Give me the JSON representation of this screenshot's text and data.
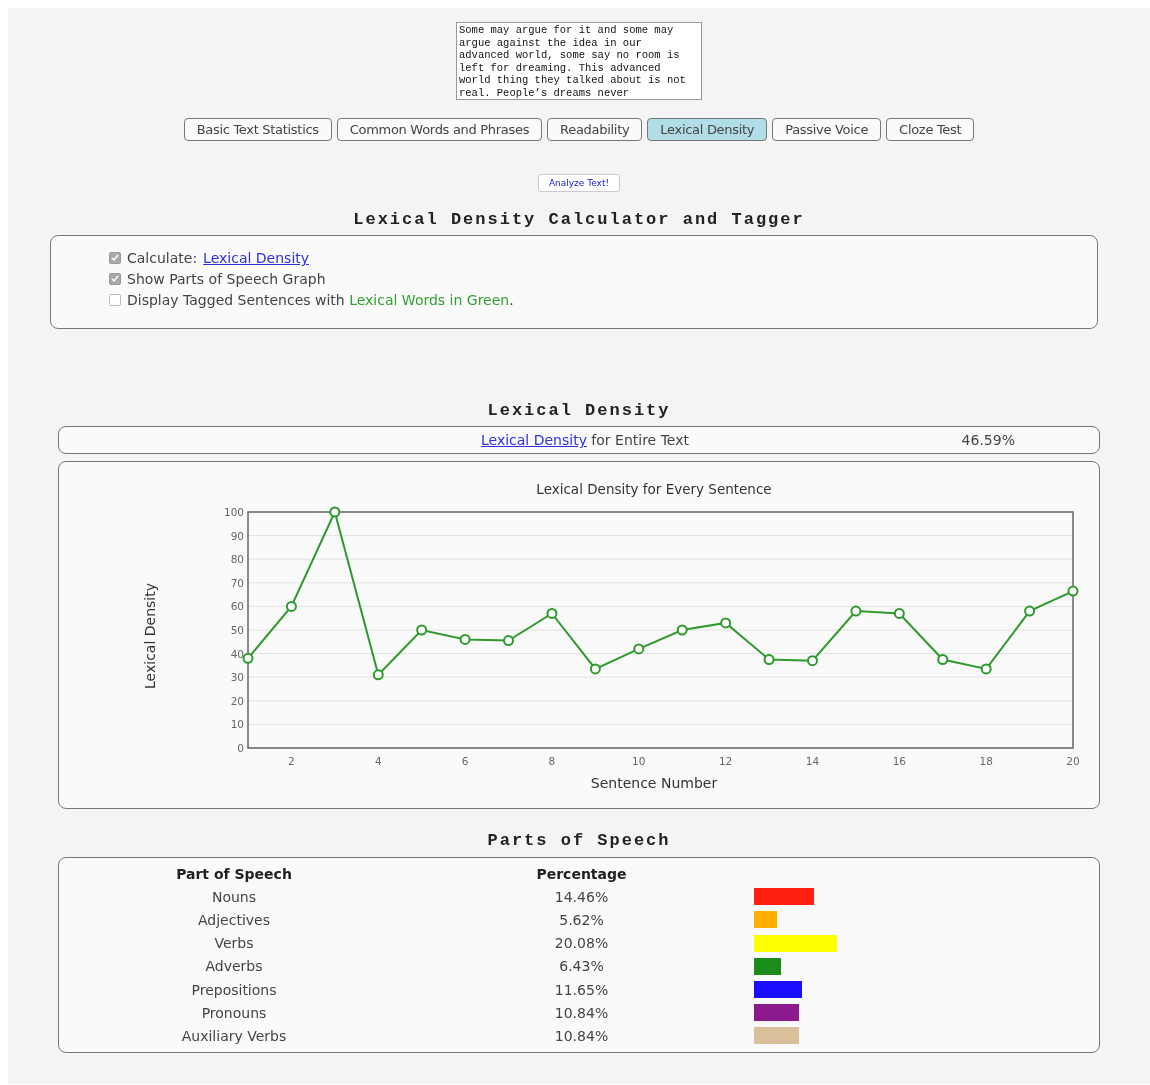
{
  "text_input": {
    "value": "Some may argue for it and some may argue against the idea in our advanced world, some say no room is left for dreaming. This advanced world thing they talked about is not real. People’s dreams never"
  },
  "tabs": [
    {
      "label": "Basic Text Statistics",
      "selected": false
    },
    {
      "label": "Common Words and Phrases",
      "selected": false
    },
    {
      "label": "Readability",
      "selected": false
    },
    {
      "label": "Lexical Density",
      "selected": true
    },
    {
      "label": "Passive Voice",
      "selected": false
    },
    {
      "label": "Cloze Test",
      "selected": false
    }
  ],
  "analyze_button": "Analyze Text!",
  "heading": "Lexical Density Calculator and Tagger",
  "options": [
    {
      "label": "Calculate: ",
      "link": "Lexical Density",
      "checked": true
    },
    {
      "label": "Show Parts of Speech Graph",
      "checked": true
    },
    {
      "label": "Display Tagged Sentences with ",
      "highlight": "Lexical Words in Green",
      "suffix": ".",
      "checked": false
    }
  ],
  "density_heading": "Lexical Density",
  "result": {
    "link": "Lexical Density",
    "label": " for Entire Text",
    "value": "46.59%"
  },
  "chart": {
    "chart_data": {
      "type": "line",
      "title": "Lexical Density for Every Sentence",
      "xlabel": "Sentence Number",
      "ylabel": "Lexical Density",
      "x": [
        1,
        2,
        3,
        4,
        5,
        6,
        7,
        8,
        9,
        10,
        11,
        12,
        13,
        14,
        15,
        16,
        17,
        18,
        19,
        20
      ],
      "grid": true,
      "series": [
        {
          "color": "#2e9a2e",
          "marker": "circle",
          "values": [
            38,
            60,
            100,
            31,
            50,
            46,
            45.5,
            57,
            33.5,
            42,
            50,
            53,
            37.5,
            37,
            58,
            57,
            37.5,
            33.5,
            58,
            66.5
          ]
        }
      ],
      "xlim": [
        1,
        20
      ],
      "ylim": [
        0,
        100
      ],
      "xticks": [
        2,
        4,
        6,
        8,
        10,
        12,
        14,
        16,
        18,
        20
      ],
      "yticks": [
        0,
        10,
        20,
        30,
        40,
        50,
        60,
        70,
        80,
        90,
        100
      ]
    }
  },
  "pos_heading": "Parts of Speech",
  "pos_table": {
    "columns": [
      "Part of Speech",
      "Percentage"
    ],
    "rows": [
      {
        "name": "Nouns",
        "percentage": "14.46%",
        "color": "#ff2010"
      },
      {
        "name": "Adjectives",
        "percentage": "5.62%",
        "color": "#ffb000"
      },
      {
        "name": "Verbs",
        "percentage": "20.08%",
        "color": "#ffff00"
      },
      {
        "name": "Adverbs",
        "percentage": "6.43%",
        "color": "#1a8c1a"
      },
      {
        "name": "Prepositions",
        "percentage": "11.65%",
        "color": "#1a10ff"
      },
      {
        "name": "Pronouns",
        "percentage": "10.84%",
        "color": "#8c1a8c"
      },
      {
        "name": "Auxiliary Verbs",
        "percentage": "10.84%",
        "color": "#d9bf9a"
      }
    ]
  }
}
